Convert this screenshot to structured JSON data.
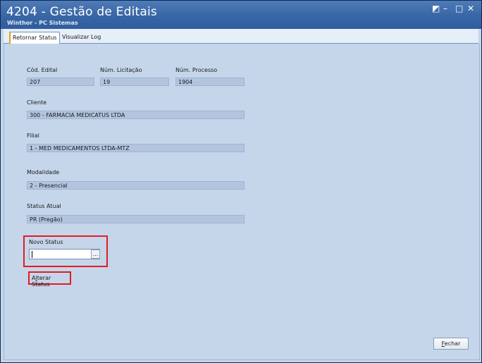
{
  "window": {
    "title": "4204 - Gestão de Editais",
    "subtitle": "Winthor - PC Sistemas",
    "controls": {
      "restore": "◩",
      "minimize": "–",
      "maximize": "□",
      "close": "✕"
    }
  },
  "tabs": [
    {
      "label": "Retornar Status",
      "active": true
    },
    {
      "label": "Visualizar Log",
      "active": false
    }
  ],
  "form": {
    "cod_edital": {
      "label": "Cód. Edital",
      "value": "207"
    },
    "num_licitacao": {
      "label": "Núm. Licitação",
      "value": "19"
    },
    "num_processo": {
      "label": "Núm. Processo",
      "value": "1904"
    },
    "cliente": {
      "label": "Cliente",
      "value": "300 - FARMACIA MEDICATUS LTDA"
    },
    "filial": {
      "label": "Filial",
      "value": "1 - MED MEDICAMENTOS LTDA-MTZ"
    },
    "modalidade": {
      "label": "Modalidade",
      "value": "2 - Presencial"
    },
    "status_atual": {
      "label": "Status Atual",
      "value": "PR (Pregão)"
    },
    "novo_status": {
      "label": "Novo Status",
      "value": "",
      "button": "..."
    }
  },
  "actions": {
    "alterar_prefix": "A",
    "alterar_mnemonic": "l",
    "alterar_rest": "terar Status",
    "fechar_mnemonic": "F",
    "fechar_rest": "echar"
  },
  "colors": {
    "titlebar": "#3a67a6",
    "panel": "#c5d6ea",
    "highlight": "#e21b23"
  }
}
